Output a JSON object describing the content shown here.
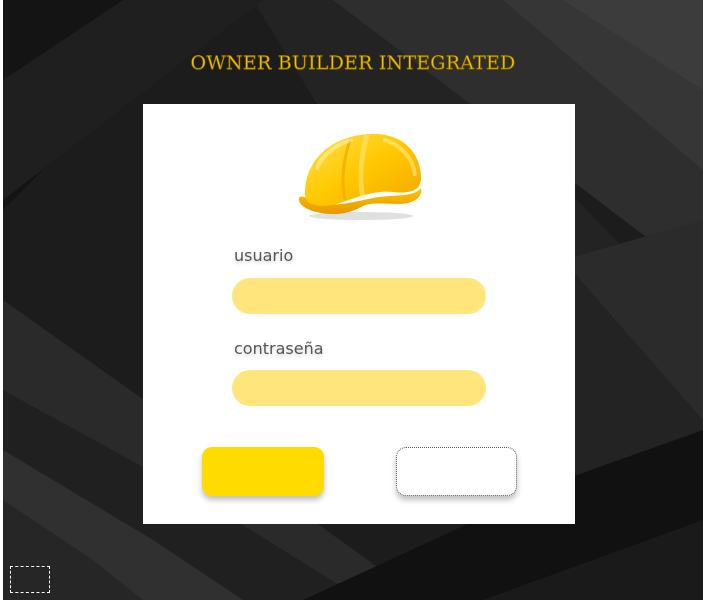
{
  "app": {
    "title": "OWNER BUILDER INTEGRATED"
  },
  "login": {
    "logo_icon": "hard-hat-icon",
    "username_label": "usuario",
    "username_value": "",
    "password_label": "contraseña",
    "password_value": "",
    "login_button_label": "",
    "register_button_label": ""
  },
  "theme": {
    "title_color": "#f2c200",
    "input_fill": "#ffe57c",
    "primary_button": "#ffdb00",
    "background": "#1a1a1a",
    "card": "#ffffff"
  }
}
